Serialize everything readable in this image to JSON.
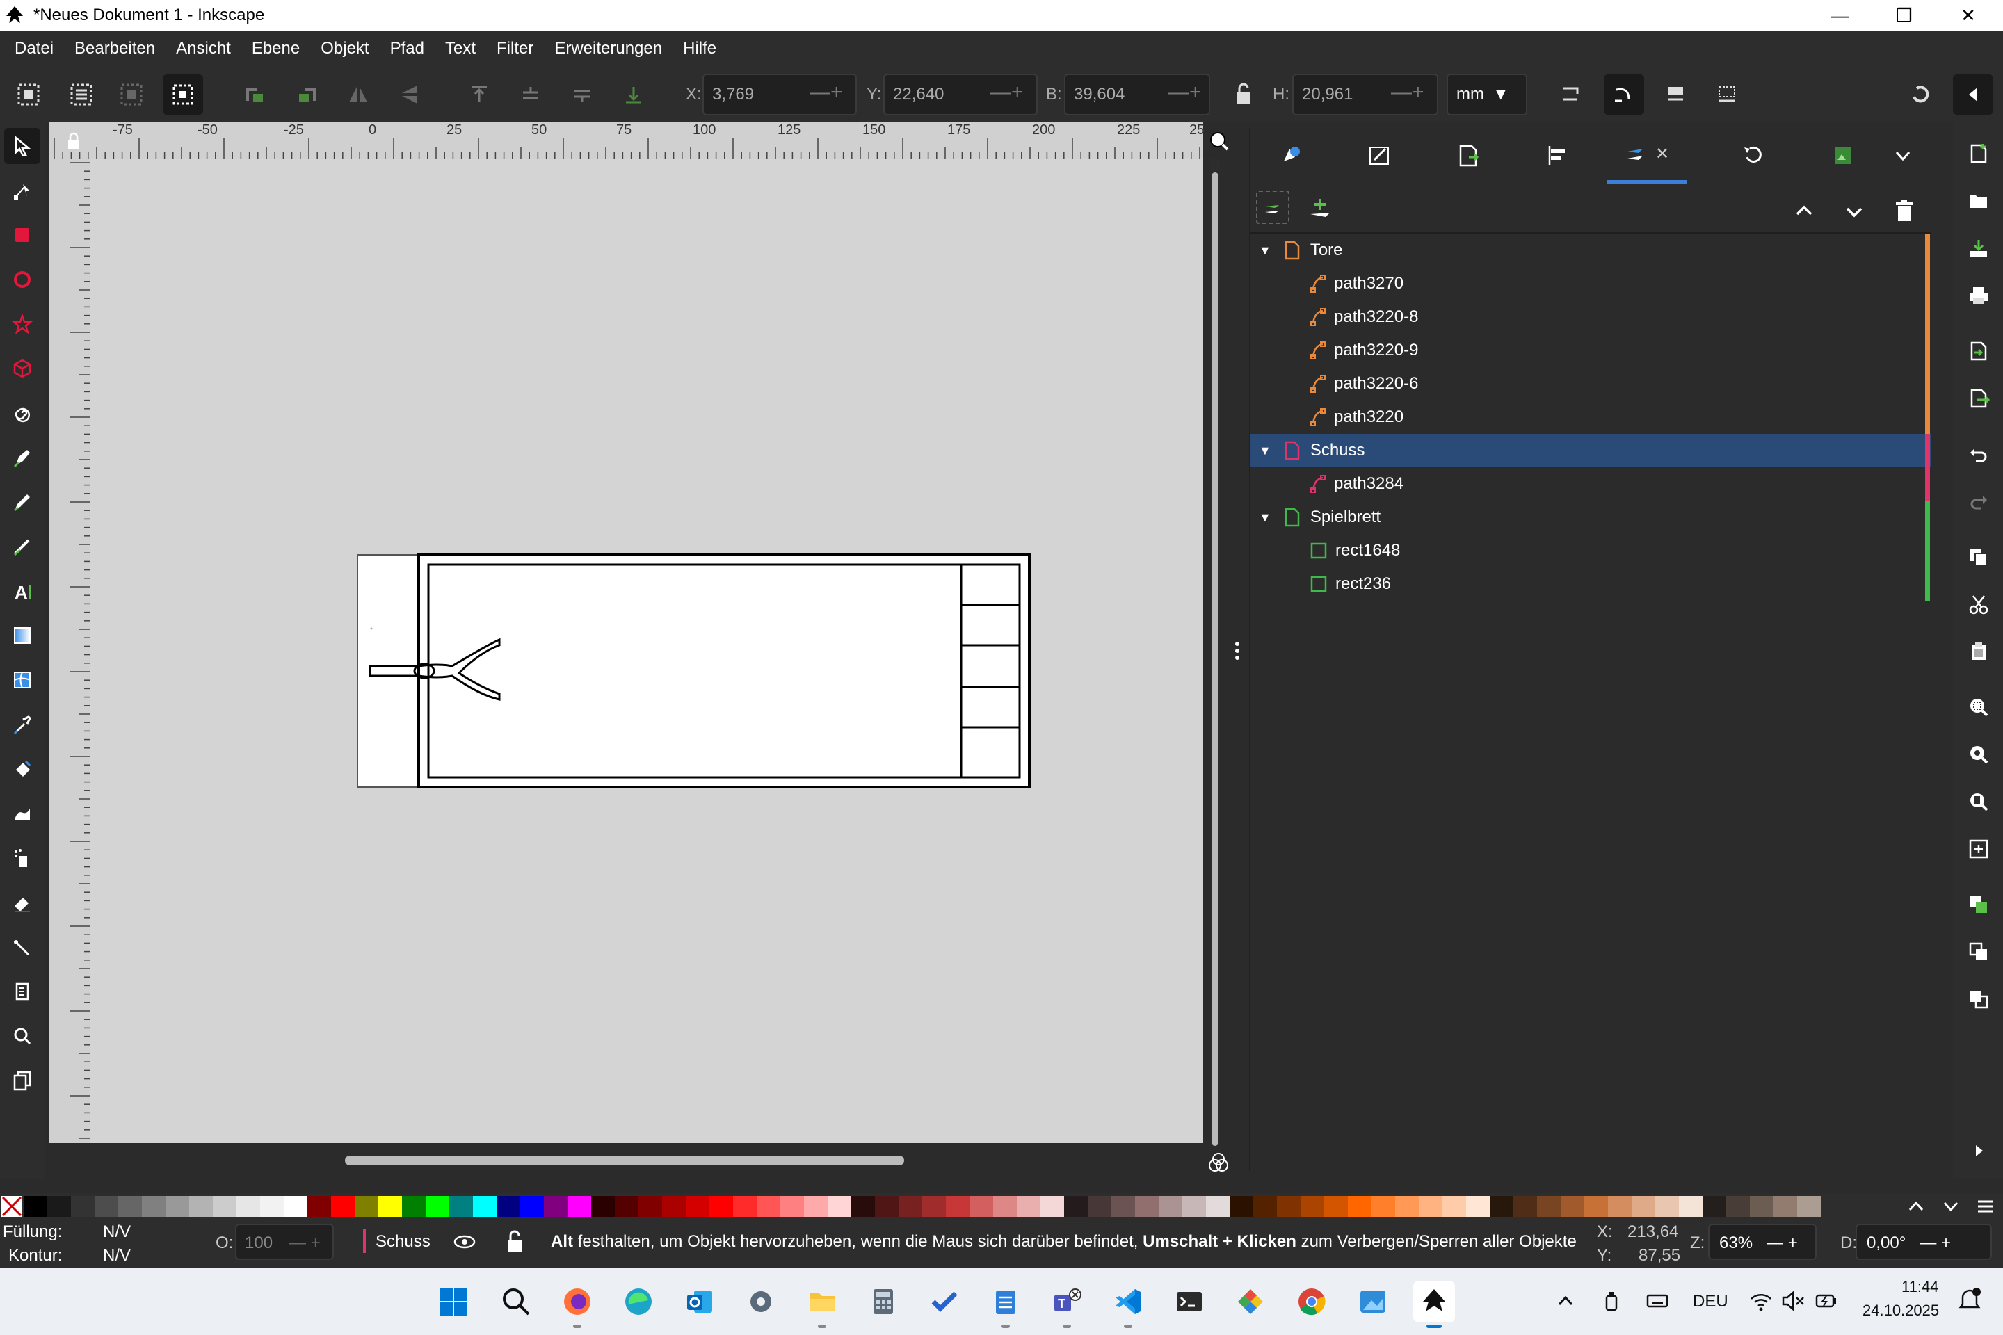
{
  "window": {
    "title": "*Neues Dokument 1 - Inkscape"
  },
  "menu": [
    "Datei",
    "Bearbeiten",
    "Ansicht",
    "Ebene",
    "Objekt",
    "Pfad",
    "Text",
    "Filter",
    "Erweiterungen",
    "Hilfe"
  ],
  "toolctrl": {
    "x_label": "X:",
    "x_value": "3,769",
    "y_label": "Y:",
    "y_value": "22,640",
    "w_label": "B:",
    "w_value": "39,604",
    "h_label": "H:",
    "h_value": "20,961",
    "unit": "mm"
  },
  "ruler": {
    "top_ticks": [
      "-75",
      "-50",
      "-25",
      "0",
      "25",
      "50",
      "75",
      "100",
      "125",
      "150",
      "175",
      "200",
      "225",
      "25"
    ]
  },
  "layers": [
    {
      "name": "Tore",
      "kind": "layer",
      "color": "#e8893b",
      "children": [
        "path3270",
        "path3220-8",
        "path3220-9",
        "path3220-6",
        "path3220"
      ]
    },
    {
      "name": "Schuss",
      "kind": "layer",
      "color": "#e0336a",
      "selected": true,
      "children": [
        "path3284"
      ]
    },
    {
      "name": "Spielbrett",
      "kind": "layer",
      "color": "#3fb94a",
      "children": [
        "rect1648",
        "rect236"
      ]
    }
  ],
  "status": {
    "fill_label": "Füllung:",
    "fill_value": "N/V",
    "stroke_label": "Kontur:",
    "stroke_value": "N/V",
    "opacity_label": "O:",
    "opacity_value": "100",
    "layer": "Schuss",
    "hint_bold1": "Alt",
    "hint_1": " festhalten, um Objekt hervorzuheben, wenn die Maus sich darüber befindet, ",
    "hint_bold2": "Umschalt + Klicken",
    "hint_2": " zum Verbergen/Sperren aller Objekte",
    "cx_label": "X:",
    "cx_value": "213,64",
    "cy_label": "Y:",
    "cy_value": "87,55",
    "zoom_label": "Z:",
    "zoom_value": "63%",
    "rot_label": "D:",
    "rot_value": "0,00°"
  },
  "taskbar": {
    "lang": "DEU",
    "time": "11:44",
    "date": "24.10.2025"
  },
  "palette": [
    "#000000",
    "#1a1a1a",
    "#333333",
    "#4d4d4d",
    "#666666",
    "#808080",
    "#999999",
    "#b3b3b3",
    "#cccccc",
    "#e6e6e6",
    "#f2f2f2",
    "#ffffff",
    "#800000",
    "#ff0000",
    "#808000",
    "#ffff00",
    "#008000",
    "#00ff00",
    "#008080",
    "#00ffff",
    "#000080",
    "#0000ff",
    "#800080",
    "#ff00ff",
    "#2b0000",
    "#550000",
    "#800000",
    "#aa0000",
    "#d40000",
    "#ff0000",
    "#ff2a2a",
    "#ff5555",
    "#ff8080",
    "#ffaaaa",
    "#ffd5d5",
    "#280b0b",
    "#501616",
    "#782121",
    "#a02c2c",
    "#c83737",
    "#d35f5f",
    "#de8787",
    "#e9afaf",
    "#f4d7d7",
    "#241c1c",
    "#483737",
    "#6c5353",
    "#916f6f",
    "#ac9393",
    "#c8b7b7",
    "#e3dbdb",
    "#2b1100",
    "#552200",
    "#803300",
    "#aa4400",
    "#d45500",
    "#ff6600",
    "#ff7f2a",
    "#ff9955",
    "#ffb380",
    "#ffccaa",
    "#ffe6d5",
    "#28170b",
    "#502d16",
    "#784421",
    "#a05a2c",
    "#c87137",
    "#d38d5f",
    "#deaa87",
    "#e9c6af",
    "#f4e3d7",
    "#241f1c",
    "#483e37",
    "#6c5d53",
    "#917c6f",
    "#ac9d93"
  ]
}
